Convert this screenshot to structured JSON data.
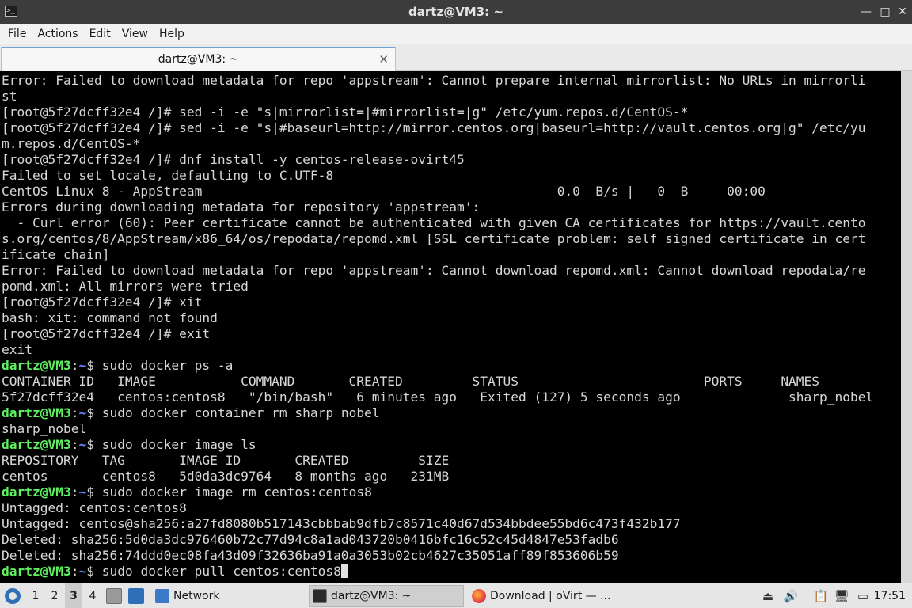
{
  "window": {
    "title": "dartz@VM3: ~",
    "minimize_glyph": "—",
    "maximize_glyph": "□",
    "close_glyph": "✕"
  },
  "menu": [
    "File",
    "Actions",
    "Edit",
    "View",
    "Help"
  ],
  "tab": {
    "label": "dartz@VM3: ~",
    "close_glyph": "✕"
  },
  "terminal": {
    "prompt": {
      "user": "dartz@VM3",
      "path": "~",
      "symbol": "$"
    },
    "lines": [
      {
        "t": "Error: Failed to download metadata for repo 'appstream': Cannot prepare internal mirrorlist: No URLs in mirrorli"
      },
      {
        "t": "st"
      },
      {
        "t": "[root@5f27dcff32e4 /]# sed -i -e \"s|mirrorlist=|#mirrorlist=|g\" /etc/yum.repos.d/CentOS-*"
      },
      {
        "t": "[root@5f27dcff32e4 /]# sed -i -e \"s|#baseurl=http://mirror.centos.org|baseurl=http://vault.centos.org|g\" /etc/yu"
      },
      {
        "t": "m.repos.d/CentOS-*"
      },
      {
        "t": "[root@5f27dcff32e4 /]# dnf install -y centos-release-ovirt45"
      },
      {
        "t": "Failed to set locale, defaulting to C.UTF-8"
      },
      {
        "t": "CentOS Linux 8 - AppStream                                              0.0  B/s |   0  B     00:00"
      },
      {
        "t": "Errors during downloading metadata for repository 'appstream':"
      },
      {
        "t": "  - Curl error (60): Peer certificate cannot be authenticated with given CA certificates for https://vault.cento"
      },
      {
        "t": "s.org/centos/8/AppStream/x86_64/os/repodata/repomd.xml [SSL certificate problem: self signed certificate in cert"
      },
      {
        "t": "ificate chain]"
      },
      {
        "t": "Error: Failed to download metadata for repo 'appstream': Cannot download repomd.xml: Cannot download repodata/re"
      },
      {
        "t": "pomd.xml: All mirrors were tried"
      },
      {
        "t": "[root@5f27dcff32e4 /]# xit"
      },
      {
        "t": "bash: xit: command not found"
      },
      {
        "t": "[root@5f27dcff32e4 /]# exit"
      },
      {
        "t": "exit"
      },
      {
        "p": true,
        "t": " sudo docker ps -a"
      },
      {
        "t": "CONTAINER ID   IMAGE           COMMAND       CREATED         STATUS                        PORTS     NAMES"
      },
      {
        "t": "5f27dcff32e4   centos:centos8   \"/bin/bash\"   6 minutes ago   Exited (127) 5 seconds ago              sharp_nobel"
      },
      {
        "p": true,
        "t": " sudo docker container rm sharp_nobel"
      },
      {
        "t": "sharp_nobel"
      },
      {
        "p": true,
        "t": " sudo docker image ls"
      },
      {
        "t": "REPOSITORY   TAG       IMAGE ID       CREATED         SIZE"
      },
      {
        "t": "centos       centos8   5d0da3dc9764   8 months ago   231MB"
      },
      {
        "p": true,
        "t": " sudo docker image rm centos:centos8"
      },
      {
        "t": "Untagged: centos:centos8"
      },
      {
        "t": "Untagged: centos@sha256:a27fd8080b517143cbbbab9dfb7c8571c40d67d534bbdee55bd6c473f432b177"
      },
      {
        "t": "Deleted: sha256:5d0da3dc976460b72c77d94c8a1ad043720b0416bfc16c52c45d4847e53fadb6"
      },
      {
        "t": "Deleted: sha256:74ddd0ec08fa43d09f32636ba91a0a3053b02cb4627c35051aff89f853606b59"
      },
      {
        "p": true,
        "t": " sudo docker pull centos:centos8",
        "cursor": true
      }
    ]
  },
  "panel": {
    "workspaces": [
      "1",
      "2",
      "3",
      "4"
    ],
    "active_workspace": "3",
    "tasks": [
      {
        "label": "Network",
        "icon": "folder-icon"
      },
      {
        "label": "dartz@VM3: ~",
        "icon": "terminal-icon",
        "active": true
      },
      {
        "label": "Download | oVirt — ...",
        "icon": "firefox-icon"
      }
    ],
    "clock": "17:51",
    "colors": {
      "brand": "#2f6fb9",
      "prompt_user": "#5ff05f",
      "prompt_path": "#6b8cff"
    }
  }
}
